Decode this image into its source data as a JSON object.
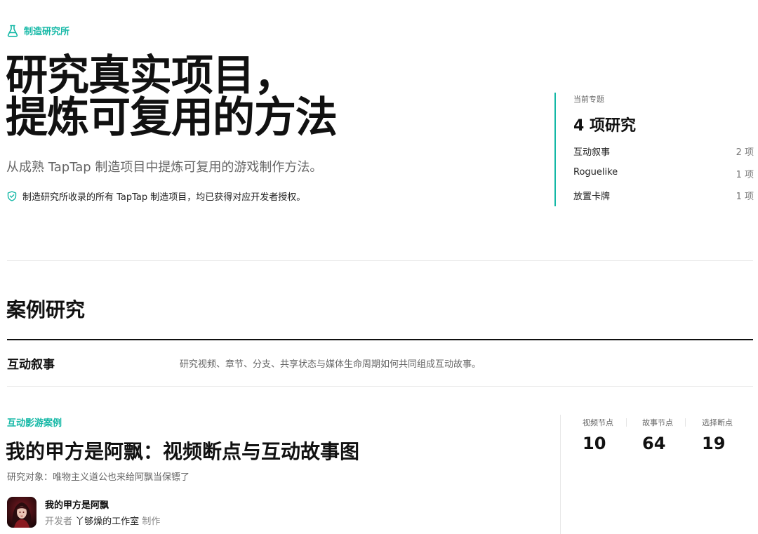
{
  "brand": {
    "label": "制造研究所",
    "icon": "flask-icon",
    "accent_color": "#14b8a6"
  },
  "hero": {
    "title_line1": "研究真实项目，",
    "title_line2": "提炼可复用的方法",
    "subtitle": "从成熟 TapTap 制造项目中提炼可复用的游戏制作方法。",
    "notice": "制造研究所收录的所有 TapTap 制造项目，均已获得对应开发者授权。",
    "notice_icon": "shield-check-icon"
  },
  "topic_panel": {
    "kicker": "当前专题",
    "count": "4 项研究",
    "items": [
      {
        "label": "互动叙事",
        "count": "2 项"
      },
      {
        "label": "Roguelike",
        "count": "1 项"
      },
      {
        "label": "放置卡牌",
        "count": "1 项"
      }
    ]
  },
  "case_section": {
    "title": "案例研究",
    "category": {
      "name": "互动叙事",
      "description": "研究视频、章节、分支、共享状态与媒体生命周期如何共同组成互动故事。"
    },
    "case": {
      "tag": "互动影游案例",
      "title": "我的甲方是阿飘：视频断点与互动故事图",
      "subject": "研究对象：唯物主义道公也来给阿飘当保镖了",
      "game": {
        "name": "我的甲方是阿飘",
        "developer_prefix": "开发者",
        "developer": "丫够燥的工作室",
        "role": "制作"
      },
      "stats": [
        {
          "label": "视频节点",
          "value": "10"
        },
        {
          "label": "故事节点",
          "value": "64"
        },
        {
          "label": "选择断点",
          "value": "19"
        }
      ]
    }
  }
}
